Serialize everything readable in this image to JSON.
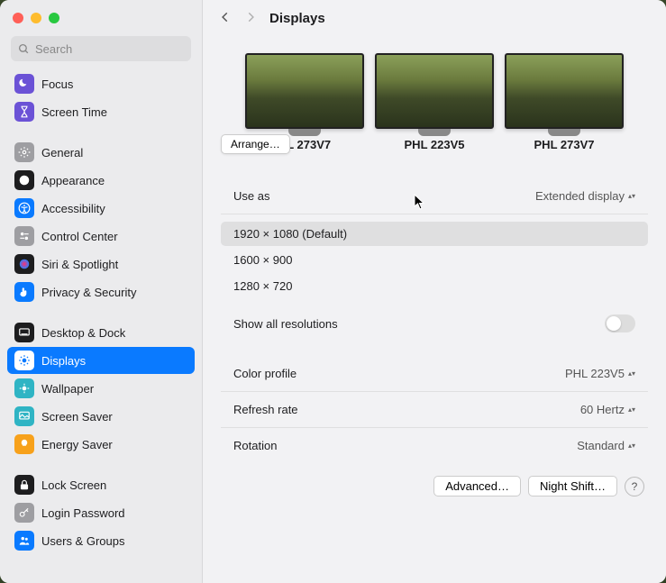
{
  "search": {
    "placeholder": "Search"
  },
  "header": {
    "title": "Displays"
  },
  "sidebar": {
    "items": [
      {
        "label": "Focus",
        "icon": "moon-icon",
        "bg": "#6b52d6",
        "fg": "#fff"
      },
      {
        "label": "Screen Time",
        "icon": "hourglass-icon",
        "bg": "#6b52d6",
        "fg": "#fff"
      },
      {
        "gap": true
      },
      {
        "label": "General",
        "icon": "gear-icon",
        "bg": "#9e9ea2",
        "fg": "#fff"
      },
      {
        "label": "Appearance",
        "icon": "appearance-icon",
        "bg": "#1d1d1f",
        "fg": "#fff"
      },
      {
        "label": "Accessibility",
        "icon": "accessibility-icon",
        "bg": "#0a7aff",
        "fg": "#fff"
      },
      {
        "label": "Control Center",
        "icon": "switches-icon",
        "bg": "#9e9ea2",
        "fg": "#fff"
      },
      {
        "label": "Siri & Spotlight",
        "icon": "siri-icon",
        "bg": "#1d1d1f",
        "fg": "#fff"
      },
      {
        "label": "Privacy & Security",
        "icon": "hand-icon",
        "bg": "#0a7aff",
        "fg": "#fff"
      },
      {
        "gap": true
      },
      {
        "label": "Desktop & Dock",
        "icon": "dock-icon",
        "bg": "#1d1d1f",
        "fg": "#fff"
      },
      {
        "label": "Displays",
        "icon": "brightness-icon",
        "bg": "#0a7aff",
        "fg": "#fff",
        "active": true
      },
      {
        "label": "Wallpaper",
        "icon": "wallpaper-icon",
        "bg": "#2fb4c4",
        "fg": "#fff"
      },
      {
        "label": "Screen Saver",
        "icon": "screensaver-icon",
        "bg": "#2fb4c4",
        "fg": "#fff"
      },
      {
        "label": "Energy Saver",
        "icon": "bulb-icon",
        "bg": "#f7a11b",
        "fg": "#fff"
      },
      {
        "gap": true
      },
      {
        "label": "Lock Screen",
        "icon": "lock-icon",
        "bg": "#1d1d1f",
        "fg": "#fff"
      },
      {
        "label": "Login Password",
        "icon": "key-icon",
        "bg": "#9e9ea2",
        "fg": "#fff"
      },
      {
        "label": "Users & Groups",
        "icon": "users-icon",
        "bg": "#0a7aff",
        "fg": "#fff"
      }
    ]
  },
  "monitors": [
    {
      "label": "HL 273V7"
    },
    {
      "label": "PHL 223V5"
    },
    {
      "label": "PHL 273V7"
    }
  ],
  "arrange_label": "Arrange…",
  "use_as": {
    "label": "Use as",
    "value": "Extended display"
  },
  "resolutions": [
    {
      "label": "1920 × 1080 (Default)",
      "selected": true
    },
    {
      "label": "1600 × 900",
      "selected": false
    },
    {
      "label": "1280 × 720",
      "selected": false
    }
  ],
  "show_all": {
    "label": "Show all resolutions",
    "on": false
  },
  "color_profile": {
    "label": "Color profile",
    "value": "PHL 223V5"
  },
  "refresh_rate": {
    "label": "Refresh rate",
    "value": "60 Hertz"
  },
  "rotation": {
    "label": "Rotation",
    "value": "Standard"
  },
  "footer": {
    "advanced": "Advanced…",
    "night_shift": "Night Shift…",
    "help": "?"
  }
}
